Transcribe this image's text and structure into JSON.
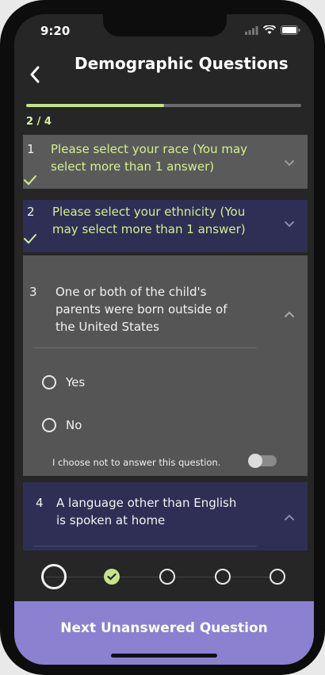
{
  "status_bar": {
    "time": "9:20"
  },
  "header": {
    "title": "Demographic Questions",
    "back_icon": "chevron-left-icon"
  },
  "progress": {
    "fraction": 0.5,
    "label": "2 / 4",
    "fill_color": "#c6e38a"
  },
  "questions": [
    {
      "number": "1",
      "text_line1": "Please select your race (You may",
      "text_line2": "select more than 1 answer)",
      "answered": true,
      "expanded": false
    },
    {
      "number": "2",
      "text_line1": "Please select your ethnicity (You",
      "text_line2": "may select more than 1 answer)",
      "answered": true,
      "expanded": false
    },
    {
      "number": "3",
      "text_line1": "One or both of the child's",
      "text_line2": "parents were born outside of",
      "text_line3": "the United States",
      "answered": false,
      "expanded": true,
      "options": [
        "Yes",
        "No"
      ],
      "decline_label": "I choose not to answer this question."
    },
    {
      "number": "4",
      "text_line1": "A language other than English",
      "text_line2": "is spoken at home",
      "answered": false,
      "expanded": true
    }
  ],
  "steps": [
    {
      "state": "current"
    },
    {
      "state": "done"
    },
    {
      "state": "todo"
    },
    {
      "state": "todo"
    },
    {
      "state": "todo"
    }
  ],
  "footer": {
    "next_label": "Next Unanswered Question"
  },
  "colors": {
    "accent_green": "#c6e38a",
    "card_purple": "#2f2f55",
    "card_gray": "#5a5a5a",
    "button_purple": "#8c80d0"
  }
}
